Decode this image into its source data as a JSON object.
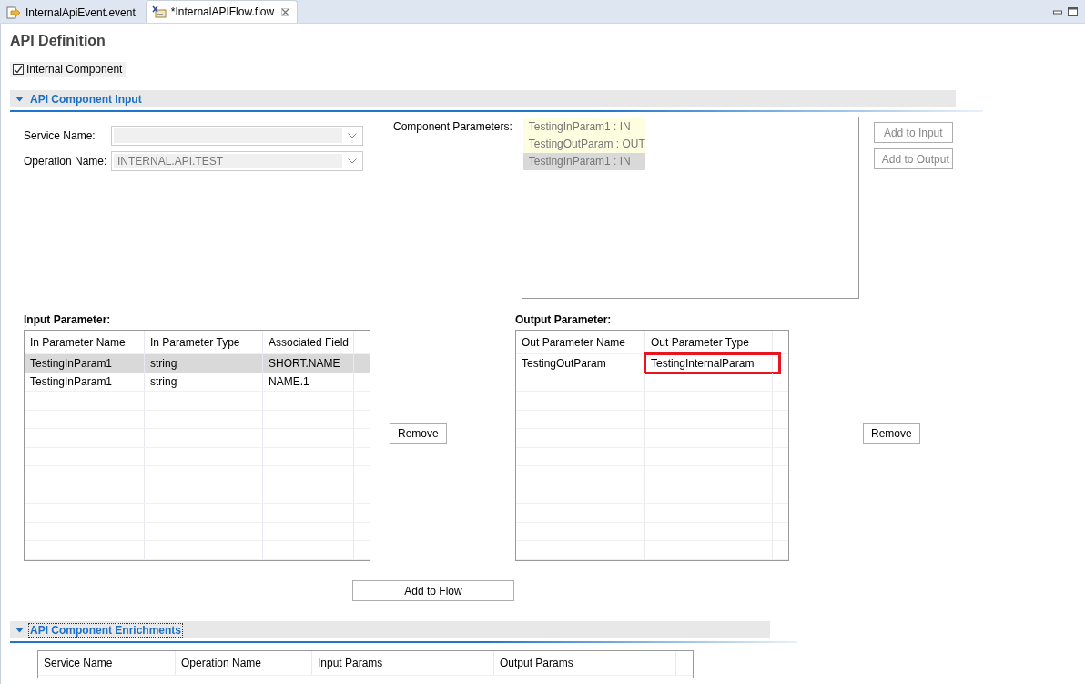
{
  "tabs": [
    {
      "label": "InternalApiEvent.event",
      "selected": false,
      "dirty_close": false
    },
    {
      "label": "*InternalAPIFlow.flow",
      "selected": true,
      "dirty_close": true
    }
  ],
  "title": "API Definition",
  "internal_component": {
    "label": "Internal Component",
    "checked": true
  },
  "sections": [
    {
      "title": "API Component Input",
      "expanded": true,
      "focused": false
    },
    {
      "title": "API Component Enrichments",
      "expanded": true,
      "focused": true
    }
  ],
  "service_name": {
    "label": "Service Name:",
    "disabled": true
  },
  "operation_name": {
    "label": "Operation Name:",
    "value": "INTERNAL.API.TEST",
    "disabled": true
  },
  "component_parameters": {
    "label": "Component Parameters:",
    "items": [
      {
        "text": "TestingInParam1 : IN",
        "selected": false
      },
      {
        "text": "TestingOutParam : OUT",
        "selected": false
      },
      {
        "text": "TestingInParam1 : IN",
        "selected": true
      }
    ]
  },
  "side_buttons": [
    {
      "label": "Add to Input",
      "disabled": true
    },
    {
      "label": "Add to Output",
      "disabled": true
    }
  ],
  "input_parameter": {
    "label": "Input Parameter:",
    "columns": [
      "In Parameter Name",
      "In Parameter Type",
      "Associated Field"
    ],
    "rows": [
      {
        "cells": [
          "TestingInParam1",
          "string",
          "SHORT.NAME"
        ],
        "selected": true,
        "highlighted": [
          false,
          false,
          false
        ]
      },
      {
        "cells": [
          "TestingInParam1",
          "string",
          "NAME.1"
        ],
        "selected": false,
        "highlighted": [
          false,
          false,
          false
        ]
      }
    ],
    "remove": "Remove"
  },
  "output_parameter": {
    "label": "Output Parameter:",
    "columns": [
      "Out Parameter Name",
      "Out Parameter Type"
    ],
    "rows": [
      {
        "cells": [
          "TestingOutParam",
          "TestingInternalParam"
        ],
        "selected": false,
        "highlighted": [
          false,
          true
        ]
      }
    ],
    "remove": "Remove"
  },
  "add_to_flow": "Add to Flow",
  "enrichments": {
    "columns": [
      "Service Name",
      "Operation Name",
      "Input Params",
      "Output Params"
    ]
  }
}
